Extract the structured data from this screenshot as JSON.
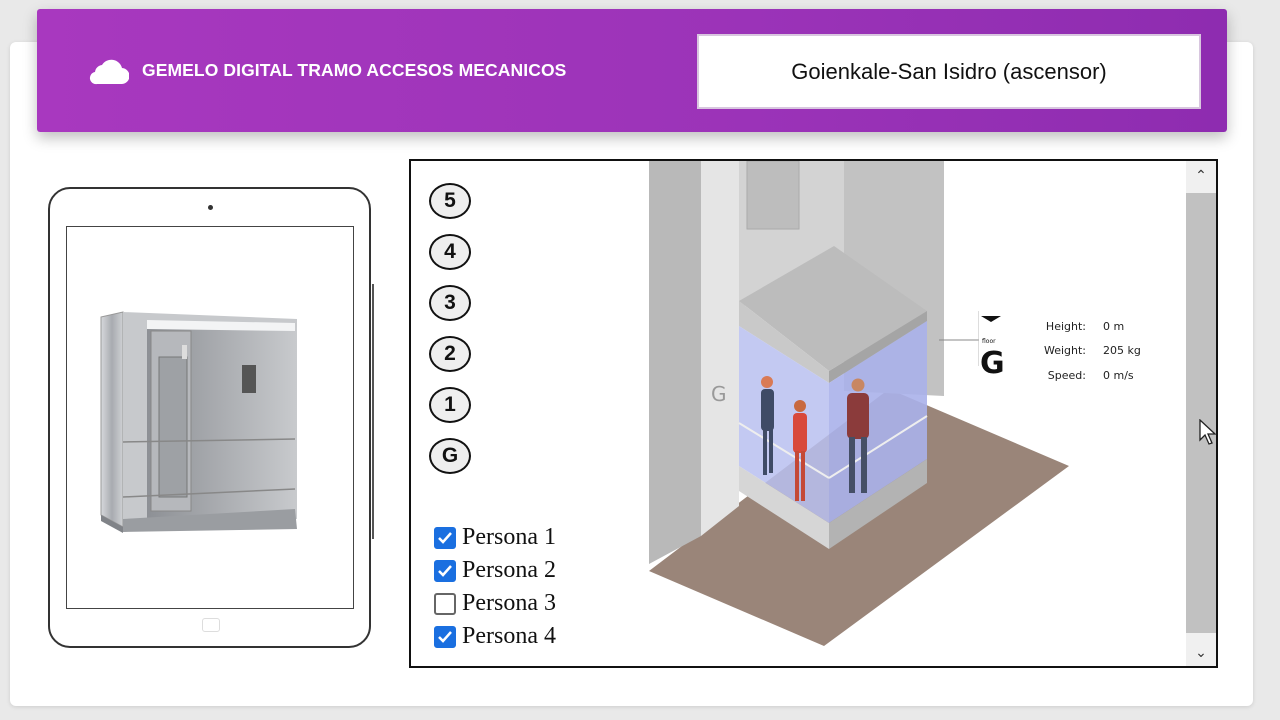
{
  "header": {
    "title": "GEMELO DIGITAL TRAMO ACCESOS MECANICOS",
    "selected_site": "Goienkale-San Isidro (ascensor)",
    "icon": "cloud-icon"
  },
  "floors": [
    "5",
    "4",
    "3",
    "2",
    "1",
    "G"
  ],
  "persons": [
    {
      "label": "Persona 1",
      "checked": true
    },
    {
      "label": "Persona 2",
      "checked": true
    },
    {
      "label": "Persona 3",
      "checked": false
    },
    {
      "label": "Persona 4",
      "checked": true
    }
  ],
  "info": {
    "floor_label": "floor",
    "floor_value": "G",
    "height_label": "Height:",
    "height_value": "0 m",
    "weight_label": "Weight:",
    "weight_value": "205 kg",
    "speed_label": "Speed:",
    "speed_value": "0 m/s"
  },
  "colors": {
    "header": "#9b33b8",
    "checkbox": "#1a6fe0",
    "floor_plate": "#9a8579",
    "glass": "#b9bff0"
  }
}
